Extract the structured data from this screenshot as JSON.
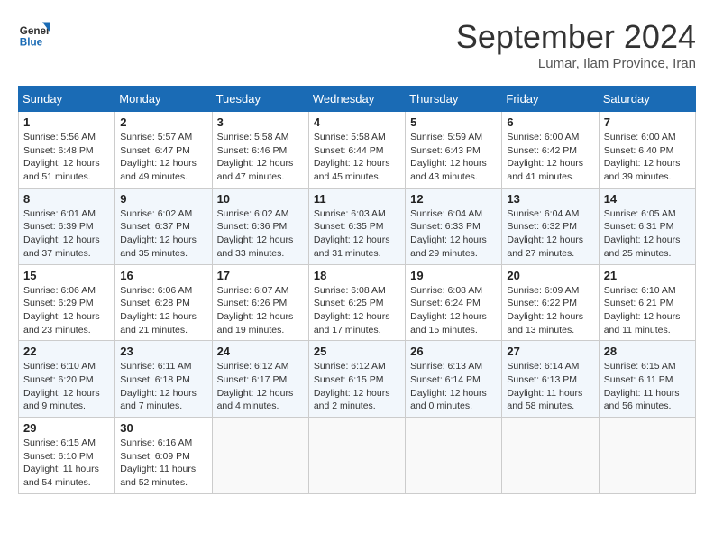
{
  "logo": {
    "line1": "General",
    "line2": "Blue"
  },
  "title": "September 2024",
  "location": "Lumar, Ilam Province, Iran",
  "weekdays": [
    "Sunday",
    "Monday",
    "Tuesday",
    "Wednesday",
    "Thursday",
    "Friday",
    "Saturday"
  ],
  "weeks": [
    [
      {
        "day": 1,
        "sunrise": "5:56 AM",
        "sunset": "6:48 PM",
        "daylight": "12 hours and 51 minutes."
      },
      {
        "day": 2,
        "sunrise": "5:57 AM",
        "sunset": "6:47 PM",
        "daylight": "12 hours and 49 minutes."
      },
      {
        "day": 3,
        "sunrise": "5:58 AM",
        "sunset": "6:46 PM",
        "daylight": "12 hours and 47 minutes."
      },
      {
        "day": 4,
        "sunrise": "5:58 AM",
        "sunset": "6:44 PM",
        "daylight": "12 hours and 45 minutes."
      },
      {
        "day": 5,
        "sunrise": "5:59 AM",
        "sunset": "6:43 PM",
        "daylight": "12 hours and 43 minutes."
      },
      {
        "day": 6,
        "sunrise": "6:00 AM",
        "sunset": "6:42 PM",
        "daylight": "12 hours and 41 minutes."
      },
      {
        "day": 7,
        "sunrise": "6:00 AM",
        "sunset": "6:40 PM",
        "daylight": "12 hours and 39 minutes."
      }
    ],
    [
      {
        "day": 8,
        "sunrise": "6:01 AM",
        "sunset": "6:39 PM",
        "daylight": "12 hours and 37 minutes."
      },
      {
        "day": 9,
        "sunrise": "6:02 AM",
        "sunset": "6:37 PM",
        "daylight": "12 hours and 35 minutes."
      },
      {
        "day": 10,
        "sunrise": "6:02 AM",
        "sunset": "6:36 PM",
        "daylight": "12 hours and 33 minutes."
      },
      {
        "day": 11,
        "sunrise": "6:03 AM",
        "sunset": "6:35 PM",
        "daylight": "12 hours and 31 minutes."
      },
      {
        "day": 12,
        "sunrise": "6:04 AM",
        "sunset": "6:33 PM",
        "daylight": "12 hours and 29 minutes."
      },
      {
        "day": 13,
        "sunrise": "6:04 AM",
        "sunset": "6:32 PM",
        "daylight": "12 hours and 27 minutes."
      },
      {
        "day": 14,
        "sunrise": "6:05 AM",
        "sunset": "6:31 PM",
        "daylight": "12 hours and 25 minutes."
      }
    ],
    [
      {
        "day": 15,
        "sunrise": "6:06 AM",
        "sunset": "6:29 PM",
        "daylight": "12 hours and 23 minutes."
      },
      {
        "day": 16,
        "sunrise": "6:06 AM",
        "sunset": "6:28 PM",
        "daylight": "12 hours and 21 minutes."
      },
      {
        "day": 17,
        "sunrise": "6:07 AM",
        "sunset": "6:26 PM",
        "daylight": "12 hours and 19 minutes."
      },
      {
        "day": 18,
        "sunrise": "6:08 AM",
        "sunset": "6:25 PM",
        "daylight": "12 hours and 17 minutes."
      },
      {
        "day": 19,
        "sunrise": "6:08 AM",
        "sunset": "6:24 PM",
        "daylight": "12 hours and 15 minutes."
      },
      {
        "day": 20,
        "sunrise": "6:09 AM",
        "sunset": "6:22 PM",
        "daylight": "12 hours and 13 minutes."
      },
      {
        "day": 21,
        "sunrise": "6:10 AM",
        "sunset": "6:21 PM",
        "daylight": "12 hours and 11 minutes."
      }
    ],
    [
      {
        "day": 22,
        "sunrise": "6:10 AM",
        "sunset": "6:20 PM",
        "daylight": "12 hours and 9 minutes."
      },
      {
        "day": 23,
        "sunrise": "6:11 AM",
        "sunset": "6:18 PM",
        "daylight": "12 hours and 7 minutes."
      },
      {
        "day": 24,
        "sunrise": "6:12 AM",
        "sunset": "6:17 PM",
        "daylight": "12 hours and 4 minutes."
      },
      {
        "day": 25,
        "sunrise": "6:12 AM",
        "sunset": "6:15 PM",
        "daylight": "12 hours and 2 minutes."
      },
      {
        "day": 26,
        "sunrise": "6:13 AM",
        "sunset": "6:14 PM",
        "daylight": "12 hours and 0 minutes."
      },
      {
        "day": 27,
        "sunrise": "6:14 AM",
        "sunset": "6:13 PM",
        "daylight": "11 hours and 58 minutes."
      },
      {
        "day": 28,
        "sunrise": "6:15 AM",
        "sunset": "6:11 PM",
        "daylight": "11 hours and 56 minutes."
      }
    ],
    [
      {
        "day": 29,
        "sunrise": "6:15 AM",
        "sunset": "6:10 PM",
        "daylight": "11 hours and 54 minutes."
      },
      {
        "day": 30,
        "sunrise": "6:16 AM",
        "sunset": "6:09 PM",
        "daylight": "11 hours and 52 minutes."
      },
      null,
      null,
      null,
      null,
      null
    ]
  ],
  "labels": {
    "sunrise": "Sunrise:",
    "sunset": "Sunset:",
    "daylight": "Daylight:"
  }
}
